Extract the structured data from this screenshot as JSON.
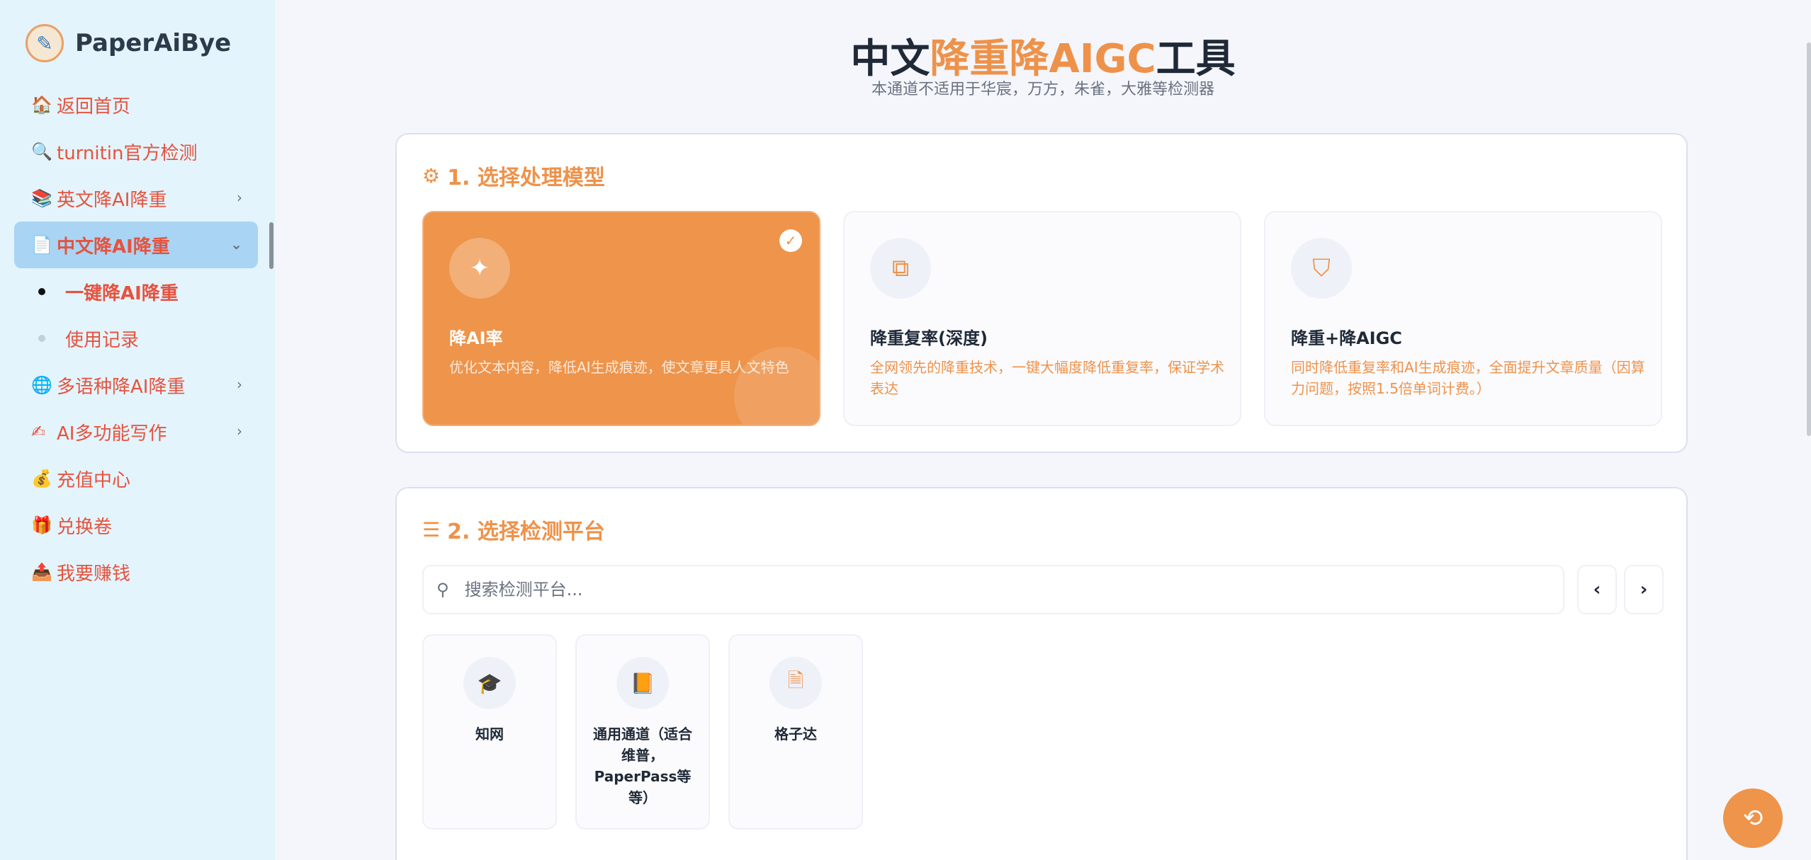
{
  "sidebar": {
    "brand": "PaperAiBye",
    "items": [
      {
        "label": "返回首页",
        "icon": "house-icon"
      },
      {
        "label": "turnitin官方检测",
        "icon": "magnifier-icon"
      },
      {
        "label": "英文降AI降重",
        "icon": "books-icon"
      },
      {
        "label": "中文降AI降重",
        "icon": "document-icon"
      },
      {
        "label": "多语种降AI降重",
        "icon": "globe-icon"
      },
      {
        "label": "AI多功能写作",
        "icon": "writing-hand-icon"
      },
      {
        "label": "充值中心",
        "icon": "money-bag-icon"
      },
      {
        "label": "兑换卷",
        "icon": "gift-icon"
      },
      {
        "label": "我要赚钱",
        "icon": "outbox-icon"
      }
    ],
    "sub_items": [
      {
        "label": "一键降AI降重"
      },
      {
        "label": "使用记录"
      }
    ]
  },
  "header": {
    "title_prefix": "中文",
    "title_accent": "降重降AIGC",
    "title_suffix": "工具",
    "subtitle": "本通道不适用于华宸，万方，朱雀，大雅等检测器"
  },
  "section1": {
    "title": "1. 选择处理模型",
    "models": [
      {
        "name": "降AI率",
        "desc": "优化文本内容，降低AI生成痕迹，使文章更具人文特色",
        "selected": true
      },
      {
        "name": "降重复率(深度)",
        "desc": "全网领先的降重技术，一键大幅度降低重复率，保证学术表达",
        "selected": false
      },
      {
        "name": "降重+降AIGC",
        "desc": "同时降低重复率和AI生成痕迹，全面提升文章质量（因算力问题，按照1.5倍单词计费。）",
        "selected": false
      }
    ]
  },
  "section2": {
    "title": "2. 选择检测平台",
    "search_placeholder": "搜索检测平台...",
    "platforms": [
      {
        "name": "知网",
        "icon": "graduation-cap-icon"
      },
      {
        "name": "通用通道（适合维普，PaperPass等等）",
        "icon": "book-icon"
      },
      {
        "name": "格子达",
        "icon": "file-icon"
      }
    ]
  },
  "colors": {
    "accent": "#ee944b",
    "nav_text": "#e5533f",
    "sidebar_bg": "#e3f4fc",
    "active_item": "#a9d4f3"
  }
}
